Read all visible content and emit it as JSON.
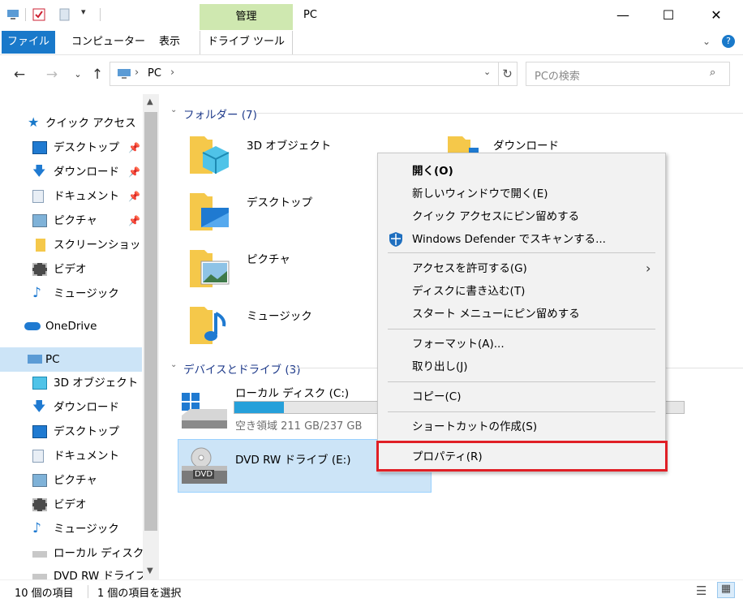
{
  "window": {
    "title": "PC",
    "manage_tab": "管理",
    "minimize_icon": "minimize-icon",
    "maximize_icon": "maximize-icon",
    "close_icon": "close-icon"
  },
  "ribbon": {
    "tabs": [
      "ファイル",
      "コンピューター",
      "表示",
      "ドライブ ツール"
    ]
  },
  "address": {
    "path": [
      "PC"
    ],
    "search_placeholder": "PCの検索"
  },
  "nav": {
    "quick_access": "クイック アクセス",
    "quick_items": [
      "デスクトップ",
      "ダウンロード",
      "ドキュメント",
      "ピクチャ",
      "スクリーンショット",
      "ビデオ",
      "ミュージック"
    ],
    "onedrive": "OneDrive",
    "pc": "PC",
    "pc_items": [
      "3D オブジェクト",
      "ダウンロード",
      "デスクトップ",
      "ドキュメント",
      "ピクチャ",
      "ビデオ",
      "ミュージック",
      "ローカル ディスク (C",
      "DVD RW ドライブ (E"
    ]
  },
  "content": {
    "folders_header": "フォルダー (7)",
    "folders": [
      "3D オブジェクト",
      "デスクトップ",
      "ピクチャ",
      "ミュージック",
      "ダウンロード"
    ],
    "devices_header": "デバイスとドライブ (3)",
    "local_disk": {
      "name": "ローカル ディスク (C:)",
      "free": "空き領域 211 GB/237 GB",
      "used_fraction": 0.11
    },
    "dvd": {
      "name": "DVD RW ドライブ (E:)",
      "badge": "DVD"
    }
  },
  "context_menu": {
    "open": "開く(O)",
    "open_new_window": "新しいウィンドウで開く(E)",
    "pin_quick_access": "クイック アクセスにピン留めする",
    "defender_scan": "Windows Defender でスキャンする...",
    "give_access": "アクセスを許可する(G)",
    "burn": "ディスクに書き込む(T)",
    "pin_start": "スタート メニューにピン留めする",
    "format": "フォーマット(A)...",
    "eject": "取り出し(J)",
    "copy": "コピー(C)",
    "create_shortcut": "ショートカットの作成(S)",
    "properties": "プロパティ(R)"
  },
  "status": {
    "item_count": "10 個の項目",
    "selected": "1 個の項目を選択"
  },
  "colors": {
    "accent": "#1979ca",
    "manage_tab": "#cfe8b0",
    "selection": "#cce4f7",
    "highlight": "#e01f26",
    "group_header": "#1e3a8a"
  }
}
